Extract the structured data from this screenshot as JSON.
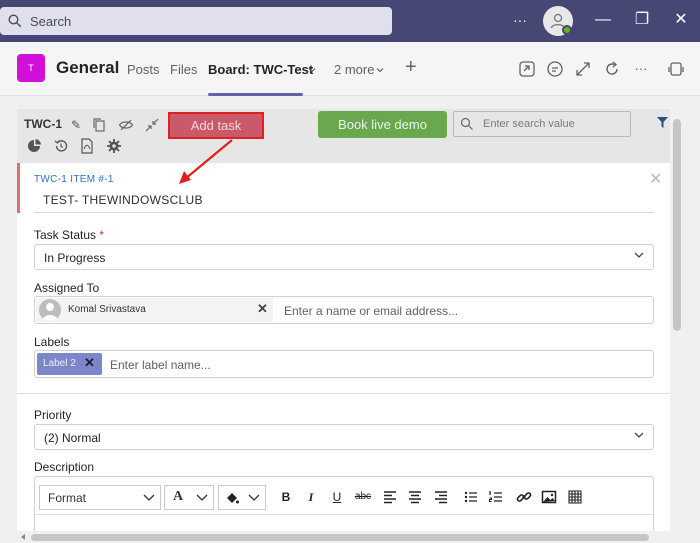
{
  "titlebar": {
    "search_placeholder": "Search",
    "more": "···",
    "minimize": "—",
    "maximize": "❐",
    "close": "✕"
  },
  "channel": {
    "team_initial": "T",
    "name": "General",
    "tabs": [
      {
        "label": "Posts"
      },
      {
        "label": "Files"
      },
      {
        "label": "Board: TWC-Test"
      },
      {
        "label": "2 more"
      }
    ],
    "add_tab": "+",
    "header_more": "···"
  },
  "toolbar": {
    "board_id": "TWC-1",
    "add_task": "Add task",
    "book_demo": "Book live demo",
    "search_placeholder": "Enter search value"
  },
  "item": {
    "code": "TWC-1 ITEM #-1",
    "title": "TEST- THEWINDOWSCLUB",
    "close": "✕"
  },
  "form": {
    "task_status": {
      "label": "Task Status",
      "required_mark": "*",
      "value": "In Progress"
    },
    "assigned_to": {
      "label": "Assigned To",
      "person": "Komal Srivastava",
      "remove": "✕",
      "placeholder": "Enter a name or email address..."
    },
    "labels": {
      "label": "Labels",
      "chip": "Label 2",
      "remove": "✕",
      "placeholder": "Enter label name..."
    },
    "priority": {
      "label": "Priority",
      "value": "(2) Normal"
    },
    "description": {
      "label": "Description",
      "format": "Format",
      "font": "A",
      "buttons": [
        "B",
        "I",
        "U",
        "abc"
      ]
    }
  },
  "colors": {
    "titlebar": "#464775",
    "accent": "#6264a7",
    "add_task_bg": "#c85a6b",
    "annotation_red": "#e02020",
    "demo_green": "#6aa84f",
    "team_tile": "#d20fd8"
  }
}
